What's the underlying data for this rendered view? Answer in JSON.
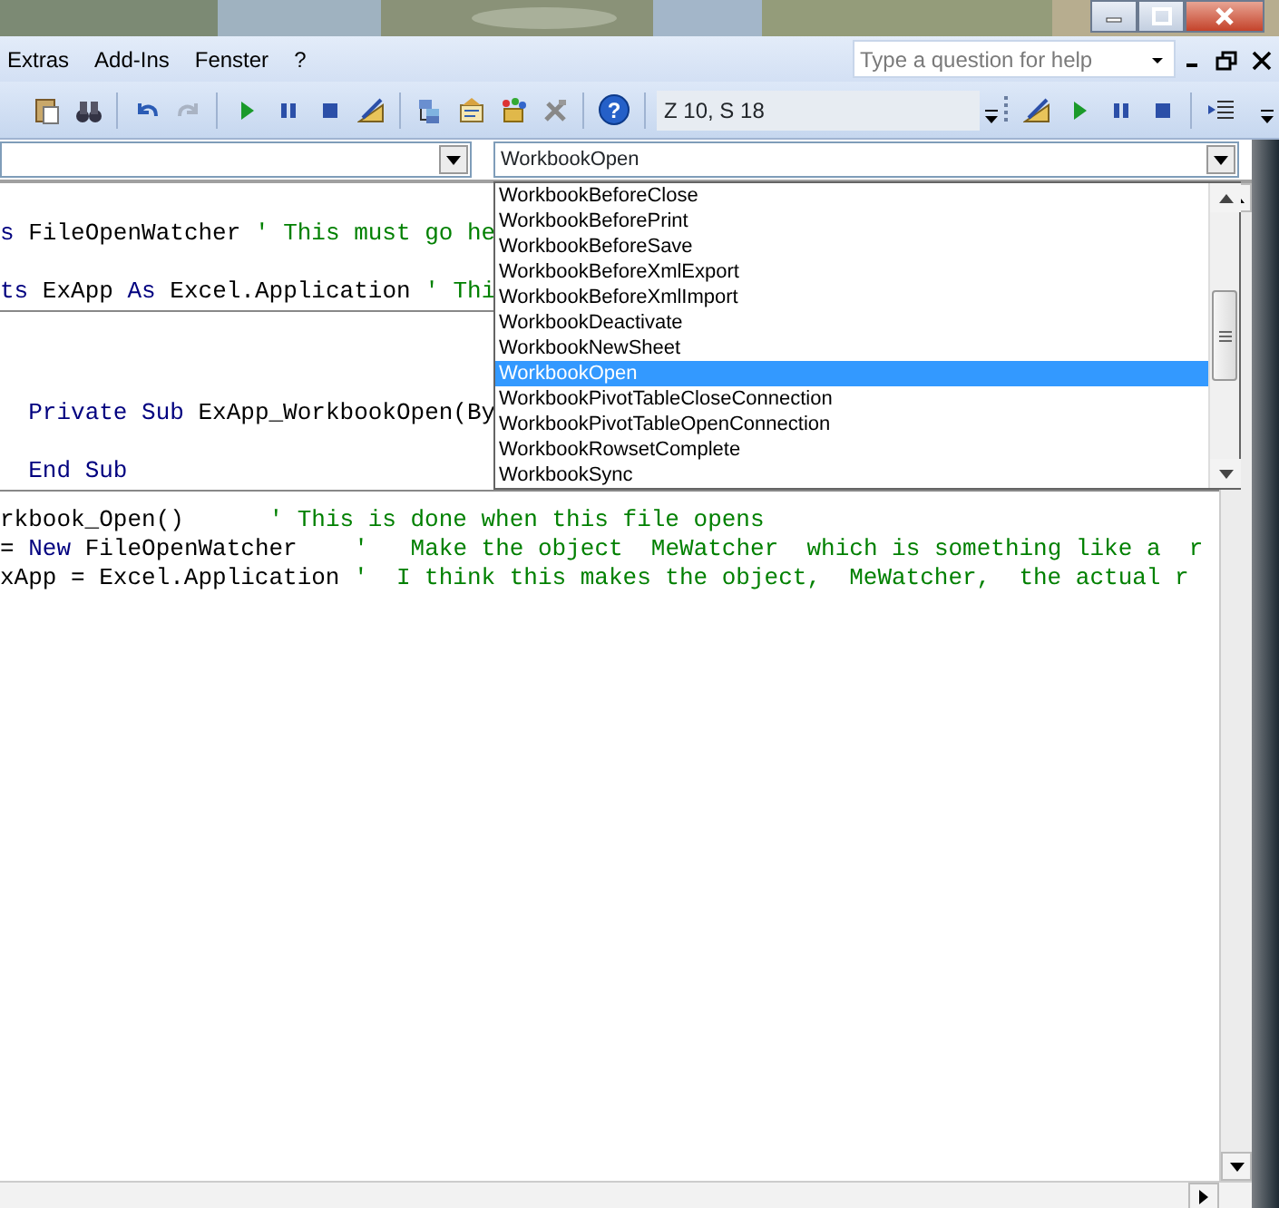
{
  "menu": [
    {
      "label": "Extras"
    },
    {
      "label": "Add-Ins"
    },
    {
      "label": "Fenster"
    },
    {
      "label": "?"
    }
  ],
  "help_box": {
    "placeholder": "Type a question for help"
  },
  "toolbar": {
    "help_glyph": "?",
    "position": "Z 10, S 18"
  },
  "procedure_combo": {
    "value": "WorkbookOpen",
    "expanded": true
  },
  "procedure_list": [
    {
      "label": "WorkbookBeforeClose",
      "selected": false
    },
    {
      "label": "WorkbookBeforePrint",
      "selected": false
    },
    {
      "label": "WorkbookBeforeSave",
      "selected": false
    },
    {
      "label": "WorkbookBeforeXmlExport",
      "selected": false
    },
    {
      "label": "WorkbookBeforeXmlImport",
      "selected": false
    },
    {
      "label": "WorkbookDeactivate",
      "selected": false
    },
    {
      "label": "WorkbookNewSheet",
      "selected": false
    },
    {
      "label": "WorkbookOpen",
      "selected": true
    },
    {
      "label": "WorkbookPivotTableCloseConnection",
      "selected": false
    },
    {
      "label": "WorkbookPivotTableOpenConnection",
      "selected": false
    },
    {
      "label": "WorkbookRowsetComplete",
      "selected": false
    },
    {
      "label": "WorkbookSync",
      "selected": false
    }
  ],
  "code_blocks": [
    {
      "lines": [
        {
          "kind": "blank"
        },
        {
          "kind": "code",
          "segments": [
            {
              "kind": "keyword",
              "text": "s"
            },
            {
              "kind": "plain",
              "text": " FileOpenWatcher "
            },
            {
              "kind": "comment",
              "text": "' This must go he"
            }
          ]
        },
        {
          "kind": "blank"
        },
        {
          "kind": "code",
          "segments": [
            {
              "kind": "keyword",
              "text": "ts"
            },
            {
              "kind": "plain",
              "text": " ExApp "
            },
            {
              "kind": "keyword",
              "text": "As"
            },
            {
              "kind": "plain",
              "text": " Excel.Application "
            },
            {
              "kind": "comment",
              "text": "' Thi"
            }
          ]
        }
      ]
    },
    {
      "lines": [
        {
          "kind": "blank"
        },
        {
          "kind": "blank"
        },
        {
          "kind": "blank"
        },
        {
          "kind": "code",
          "segments": [
            {
              "kind": "keyword",
              "text": "  Private Sub"
            },
            {
              "kind": "plain",
              "text": " ExApp_WorkbookOpen(By"
            }
          ]
        },
        {
          "kind": "blank"
        },
        {
          "kind": "code",
          "segments": [
            {
              "kind": "keyword",
              "text": "  End Sub"
            }
          ]
        }
      ]
    },
    {
      "lines": [
        {
          "kind": "half"
        },
        {
          "kind": "code",
          "segments": [
            {
              "kind": "plain",
              "text": "rkbook_Open()      "
            },
            {
              "kind": "comment",
              "text": "' This is done when this file opens"
            }
          ]
        },
        {
          "kind": "code",
          "segments": [
            {
              "kind": "plain",
              "text": "= "
            },
            {
              "kind": "keyword",
              "text": "New"
            },
            {
              "kind": "plain",
              "text": " FileOpenWatcher    "
            },
            {
              "kind": "comment",
              "text": "'   Make the object  MeWatcher  which is something like a  r"
            }
          ]
        },
        {
          "kind": "code",
          "segments": [
            {
              "kind": "plain",
              "text": "xApp = Excel.Application "
            },
            {
              "kind": "comment",
              "text": "'  I think this makes the object,  MeWatcher,  the actual r"
            }
          ]
        }
      ]
    }
  ]
}
